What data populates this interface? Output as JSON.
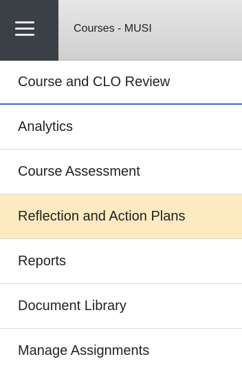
{
  "header": {
    "title": "Courses - MUSI",
    "menu_icon": "hamburger-menu-icon"
  },
  "menu": {
    "items": [
      {
        "label": "Course and CLO Review"
      },
      {
        "label": "Analytics"
      },
      {
        "label": "Course Assessment"
      },
      {
        "label": "Reflection and Action Plans",
        "highlighted": true
      },
      {
        "label": "Reports"
      },
      {
        "label": "Document Library"
      },
      {
        "label": "Manage Assignments"
      }
    ]
  },
  "colors": {
    "menu_button_bg": "#3b4046",
    "title_bar_bg": "#d9d9d9",
    "highlight_bg": "#fdeac1",
    "accent_line": "#3b6cc4"
  }
}
